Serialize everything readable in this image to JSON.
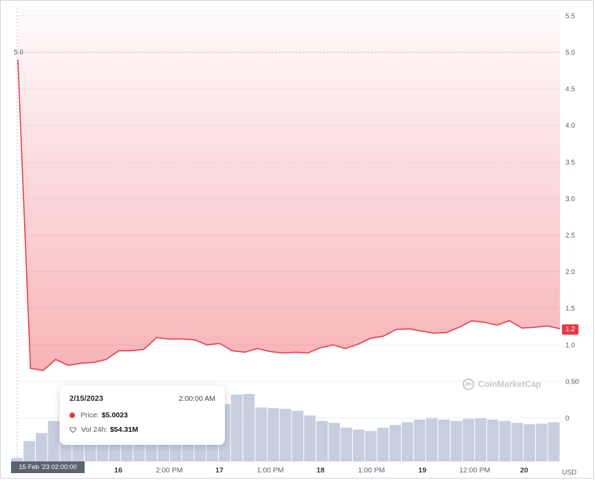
{
  "chart_data": {
    "type": "area",
    "y_axis": {
      "ticks": [
        "5.5",
        "5.0",
        "4.5",
        "4.0",
        "3.5",
        "3.0",
        "2.5",
        "2.0",
        "1.5",
        "1.0",
        "0.50",
        "0"
      ],
      "tick_values": [
        5.5,
        5.0,
        4.5,
        4.0,
        3.5,
        3.0,
        2.5,
        2.0,
        1.5,
        1.0,
        0.5,
        0
      ],
      "ylim": [
        0,
        5.6
      ],
      "position": "right",
      "unit": "USD"
    },
    "x_axis": {
      "ticks": [
        {
          "label": "16",
          "bold": true
        },
        {
          "label": "2:00 PM",
          "bold": false
        },
        {
          "label": "17",
          "bold": true
        },
        {
          "label": "1:00 PM",
          "bold": false
        },
        {
          "label": "18",
          "bold": true
        },
        {
          "label": "1:00 PM",
          "bold": false
        },
        {
          "label": "19",
          "bold": true
        },
        {
          "label": "12:00 PM",
          "bold": false
        },
        {
          "label": "20",
          "bold": true
        }
      ],
      "range_start": "15 Feb '23 02:00:00"
    },
    "series": [
      {
        "kind": "price",
        "color": "#ea3943",
        "values": [
          4.9,
          0.68,
          0.65,
          0.8,
          0.72,
          0.75,
          0.76,
          0.8,
          0.92,
          0.92,
          0.94,
          1.1,
          1.08,
          1.08,
          1.07,
          1.0,
          1.02,
          0.92,
          0.9,
          0.95,
          0.91,
          0.89,
          0.9,
          0.89,
          0.96,
          1.0,
          0.95,
          1.01,
          1.09,
          1.12,
          1.21,
          1.22,
          1.19,
          1.16,
          1.17,
          1.24,
          1.33,
          1.31,
          1.27,
          1.33,
          1.23,
          1.24,
          1.26,
          1.22
        ]
      },
      {
        "kind": "volume",
        "color": "#c8cee0",
        "values": [
          0.05,
          0.3,
          0.42,
          0.6,
          0.62,
          0.6,
          0.58,
          0.56,
          0.56,
          0.55,
          0.55,
          0.55,
          0.56,
          0.57,
          0.58,
          0.6,
          0.65,
          0.85,
          0.99,
          1.0,
          0.8,
          0.79,
          0.78,
          0.75,
          0.68,
          0.6,
          0.57,
          0.5,
          0.47,
          0.45,
          0.5,
          0.54,
          0.58,
          0.62,
          0.64,
          0.62,
          0.6,
          0.63,
          0.64,
          0.62,
          0.6,
          0.57,
          0.55,
          0.56,
          0.58
        ]
      }
    ],
    "tooltip": {
      "date": "2/15/2023",
      "time": "2:00:00 AM",
      "price_label": "Price:",
      "price_value": "$5.0023",
      "volume_label": "Vol 24h:",
      "volume_value": "$54.31M"
    },
    "cursor_y_label": "5.0",
    "current_price_label": "1.2",
    "watermark": "CoinMarketCap",
    "grid": true
  }
}
